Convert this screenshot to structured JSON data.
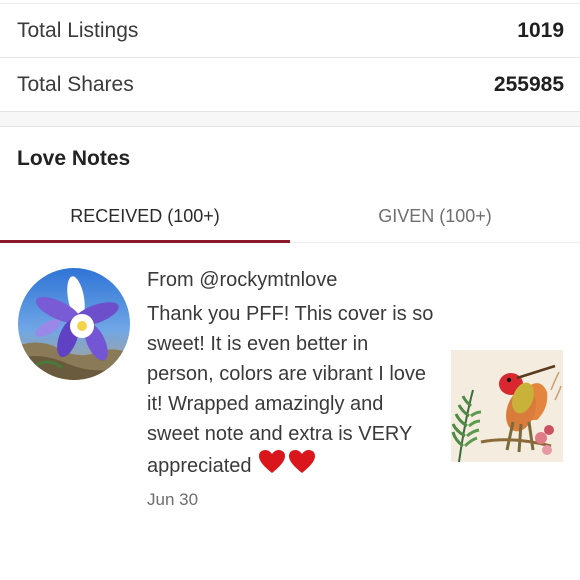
{
  "stats": {
    "total_listings_label": "Total Listings",
    "total_listings_value": "1019",
    "total_shares_label": "Total Shares",
    "total_shares_value": "255985"
  },
  "section": {
    "title": "Love Notes"
  },
  "tabs": {
    "received_label": "RECEIVED (100+)",
    "given_label": "GIVEN (100+)",
    "active": "received",
    "accent_color": "#8b1a2b"
  },
  "note": {
    "from": "From @rockymtnlove",
    "text": "Thank you PFF! This cover is so sweet! It is even better in person, colors are vibrant I love it! Wrapped amazingly and sweet note and extra is VERY appreciated",
    "emoji": "❤️❤️",
    "date": "Jun 30",
    "avatar_icon": "columbine-flower-photo",
    "thumbnail_icon": "hummingbird-illustration"
  }
}
